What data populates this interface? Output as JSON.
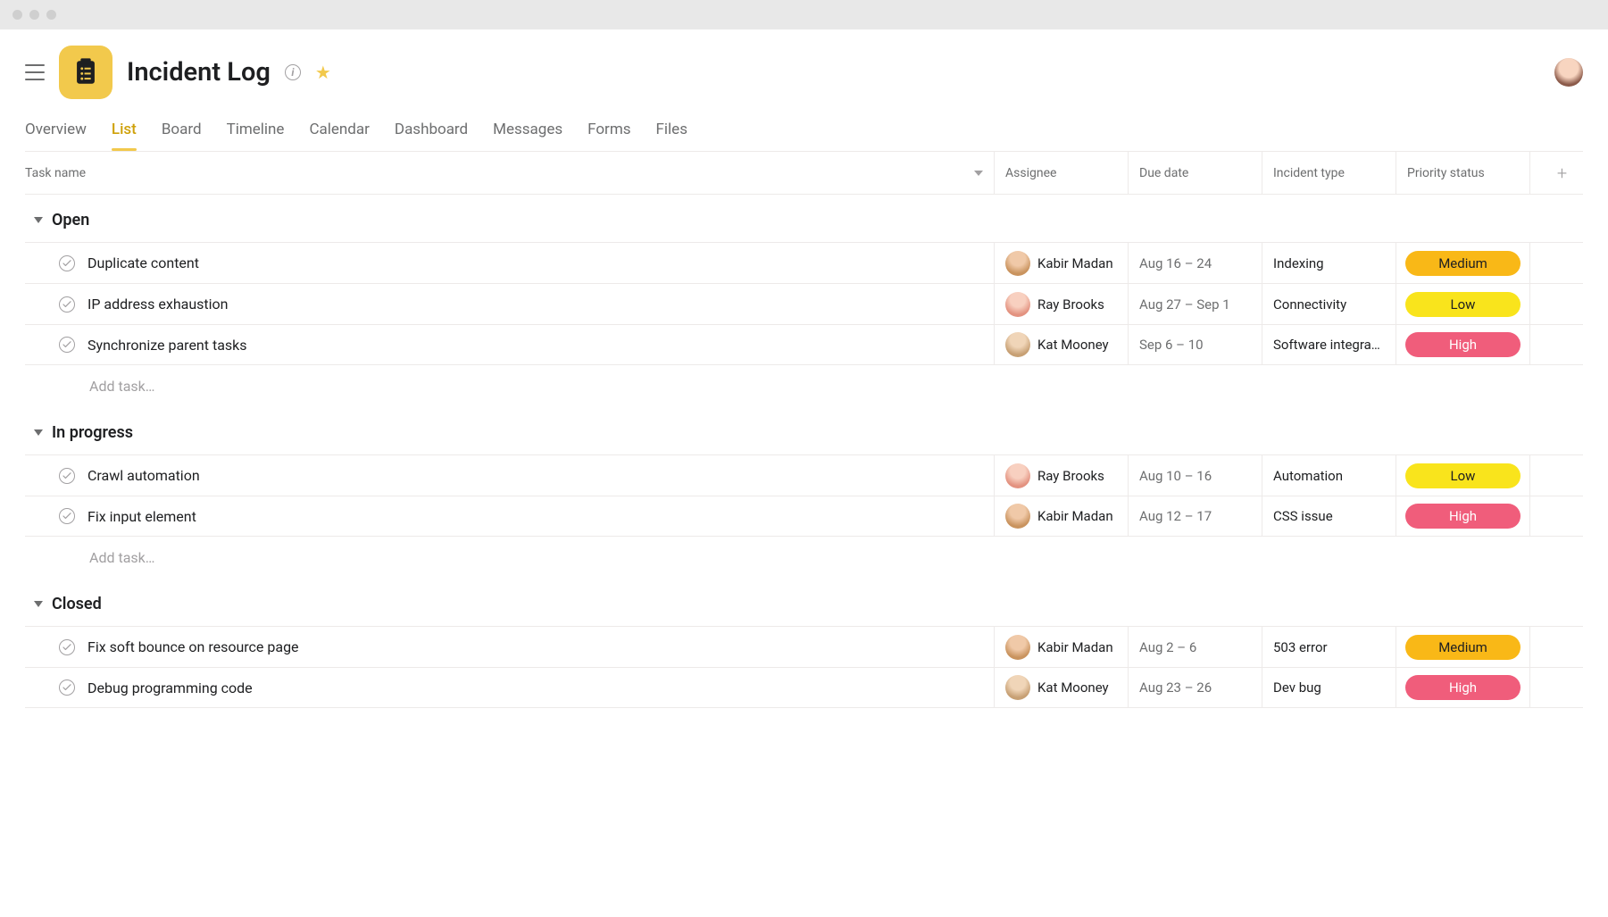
{
  "project": {
    "title": "Incident Log"
  },
  "tabs": [
    {
      "label": "Overview",
      "active": false
    },
    {
      "label": "List",
      "active": true
    },
    {
      "label": "Board",
      "active": false
    },
    {
      "label": "Timeline",
      "active": false
    },
    {
      "label": "Calendar",
      "active": false
    },
    {
      "label": "Dashboard",
      "active": false
    },
    {
      "label": "Messages",
      "active": false
    },
    {
      "label": "Forms",
      "active": false
    },
    {
      "label": "Files",
      "active": false
    }
  ],
  "columns": {
    "task": "Task name",
    "assignee": "Assignee",
    "due": "Due date",
    "type": "Incident type",
    "priority": "Priority status"
  },
  "add_task_label": "Add task…",
  "sections": [
    {
      "title": "Open",
      "tasks": [
        {
          "name": "Duplicate content",
          "assignee": "Kabir Madan",
          "avatar": "a1",
          "due": "Aug 16 – 24",
          "type": "Indexing",
          "priority": "Medium",
          "priorityClass": "medium"
        },
        {
          "name": "IP address exhaustion",
          "assignee": "Ray Brooks",
          "avatar": "a2",
          "due": "Aug 27 – Sep 1",
          "type": "Connectivity",
          "priority": "Low",
          "priorityClass": "low"
        },
        {
          "name": "Synchronize parent tasks",
          "assignee": "Kat Mooney",
          "avatar": "a3",
          "due": "Sep 6 – 10",
          "type": "Software integra…",
          "priority": "High",
          "priorityClass": "high"
        }
      ],
      "show_add": true
    },
    {
      "title": "In progress",
      "tasks": [
        {
          "name": "Crawl automation",
          "assignee": "Ray Brooks",
          "avatar": "a2",
          "due": "Aug 10 – 16",
          "type": "Automation",
          "priority": "Low",
          "priorityClass": "low"
        },
        {
          "name": "Fix input element",
          "assignee": "Kabir Madan",
          "avatar": "a1",
          "due": "Aug 12 – 17",
          "type": "CSS issue",
          "priority": "High",
          "priorityClass": "high"
        }
      ],
      "show_add": true
    },
    {
      "title": "Closed",
      "tasks": [
        {
          "name": "Fix soft bounce on resource page",
          "assignee": "Kabir Madan",
          "avatar": "a1",
          "due": "Aug 2 – 6",
          "type": "503 error",
          "priority": "Medium",
          "priorityClass": "medium"
        },
        {
          "name": "Debug programming code",
          "assignee": "Kat Mooney",
          "avatar": "a3",
          "due": "Aug 23 – 26",
          "type": "Dev bug",
          "priority": "High",
          "priorityClass": "high"
        }
      ],
      "show_add": false
    }
  ]
}
